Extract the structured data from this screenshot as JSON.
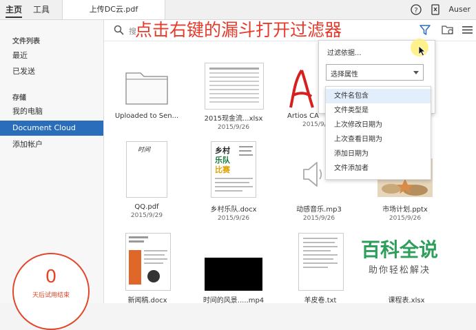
{
  "topbar": {
    "tab_home": "主页",
    "tab_tools": "工具",
    "doc_tab": "上传DC云.pdf",
    "user": "Auser",
    "icons": [
      "help-icon",
      "mobile-icon"
    ]
  },
  "sidebar": {
    "section_files": "文件列表",
    "recent": "最近",
    "sent": "已发送",
    "section_storage": "存储",
    "my_computer": "我的电脑",
    "document_cloud": "Document Cloud",
    "add_account": "添加帐户",
    "trial_number": "0",
    "trial_label": "天后试用结束"
  },
  "search": {
    "placeholder": "搜"
  },
  "annotation": "点击右键的漏斗打开过滤器",
  "files": [
    {
      "name": "Uploaded to Sen...",
      "date": ""
    },
    {
      "name": "2015现金流...xlsx",
      "date": "2015/9/26"
    },
    {
      "name": "Artios CA",
      "date": "2015/9/"
    },
    {
      "name": "QQ.pdf",
      "date": "2015/9/29"
    },
    {
      "name": "乡村乐队.docx",
      "date": "2015/9/26"
    },
    {
      "name": "动感音乐.mp3",
      "date": "2015/9/26"
    },
    {
      "name": "市场计划.pptx",
      "date": "2015/9/26"
    },
    {
      "name": "新闻稿.docx",
      "date": ""
    },
    {
      "name": "时间的风景.....mp4",
      "date": ""
    },
    {
      "name": "羊皮卷.txt",
      "date": ""
    },
    {
      "name": "课程表.xlsx",
      "date": ""
    }
  ],
  "thumb_text": {
    "qq": "时间",
    "band_1": "乡村",
    "band_2": "乐队",
    "band_3": "比赛"
  },
  "filter": {
    "title": "过滤依据...",
    "select_label": "选择属性",
    "options": [
      "文件名包含",
      "文件类型是",
      "上次修改日期为",
      "上次查看日期为",
      "添加日期为",
      "文件添加者"
    ]
  },
  "watermark": {
    "big": "百科全说",
    "small": "助你轻松解决"
  },
  "colors": {
    "accent": "#2a6ebb",
    "annotation": "#e53b2c",
    "trial": "#e0472b",
    "watermark": "#2e9e5b"
  }
}
